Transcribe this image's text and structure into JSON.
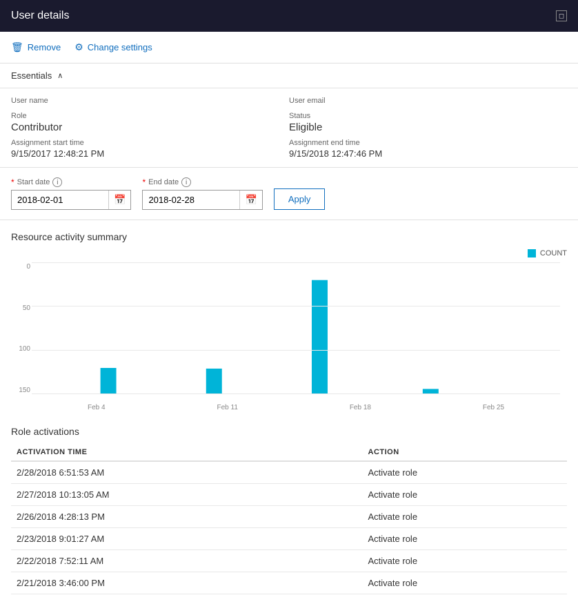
{
  "titleBar": {
    "title": "User details",
    "windowIcon": "□"
  },
  "toolbar": {
    "removeLabel": "Remove",
    "changeSettingsLabel": "Change settings"
  },
  "essentials": {
    "headerLabel": "Essentials",
    "userNameLabel": "User name",
    "userNameValue": "",
    "userEmailLabel": "User email",
    "userEmailValue": "",
    "roleLabel": "Role",
    "roleValue": "Contributor",
    "statusLabel": "Status",
    "statusValue": "Eligible",
    "assignmentStartLabel": "Assignment start time",
    "assignmentStartValue": "9/15/2017 12:48:21 PM",
    "assignmentEndLabel": "Assignment end time",
    "assignmentEndValue": "9/15/2018 12:47:46 PM"
  },
  "dateFilter": {
    "startDateLabel": "Start date",
    "startDateValue": "2018-02-01",
    "endDateLabel": "End date",
    "endDateValue": "2018-02-28",
    "applyLabel": "Apply"
  },
  "chart": {
    "title": "Resource activity summary",
    "legendLabel": "COUNT",
    "yLabels": [
      "0",
      "50",
      "100",
      "150"
    ],
    "xLabels": [
      "Feb 4",
      "Feb 11",
      "Feb 18",
      "Feb 25"
    ],
    "bars": [
      0,
      30,
      0,
      0,
      28,
      0,
      0,
      130,
      0,
      0,
      0,
      0,
      0,
      5,
      0,
      0
    ]
  },
  "roleActivations": {
    "title": "Role activations",
    "columns": [
      "ACTIVATION TIME",
      "ACTION"
    ],
    "rows": [
      {
        "time": "2/28/2018 6:51:53 AM",
        "action": "Activate role"
      },
      {
        "time": "2/27/2018 10:13:05 AM",
        "action": "Activate role"
      },
      {
        "time": "2/26/2018 4:28:13 PM",
        "action": "Activate role"
      },
      {
        "time": "2/23/2018 9:01:27 AM",
        "action": "Activate role"
      },
      {
        "time": "2/22/2018 7:52:11 AM",
        "action": "Activate role"
      },
      {
        "time": "2/21/2018 3:46:00 PM",
        "action": "Activate role"
      }
    ]
  },
  "colors": {
    "accent": "#106ebe",
    "barColor": "#00b4d8",
    "titleBg": "#1e1f2e"
  }
}
